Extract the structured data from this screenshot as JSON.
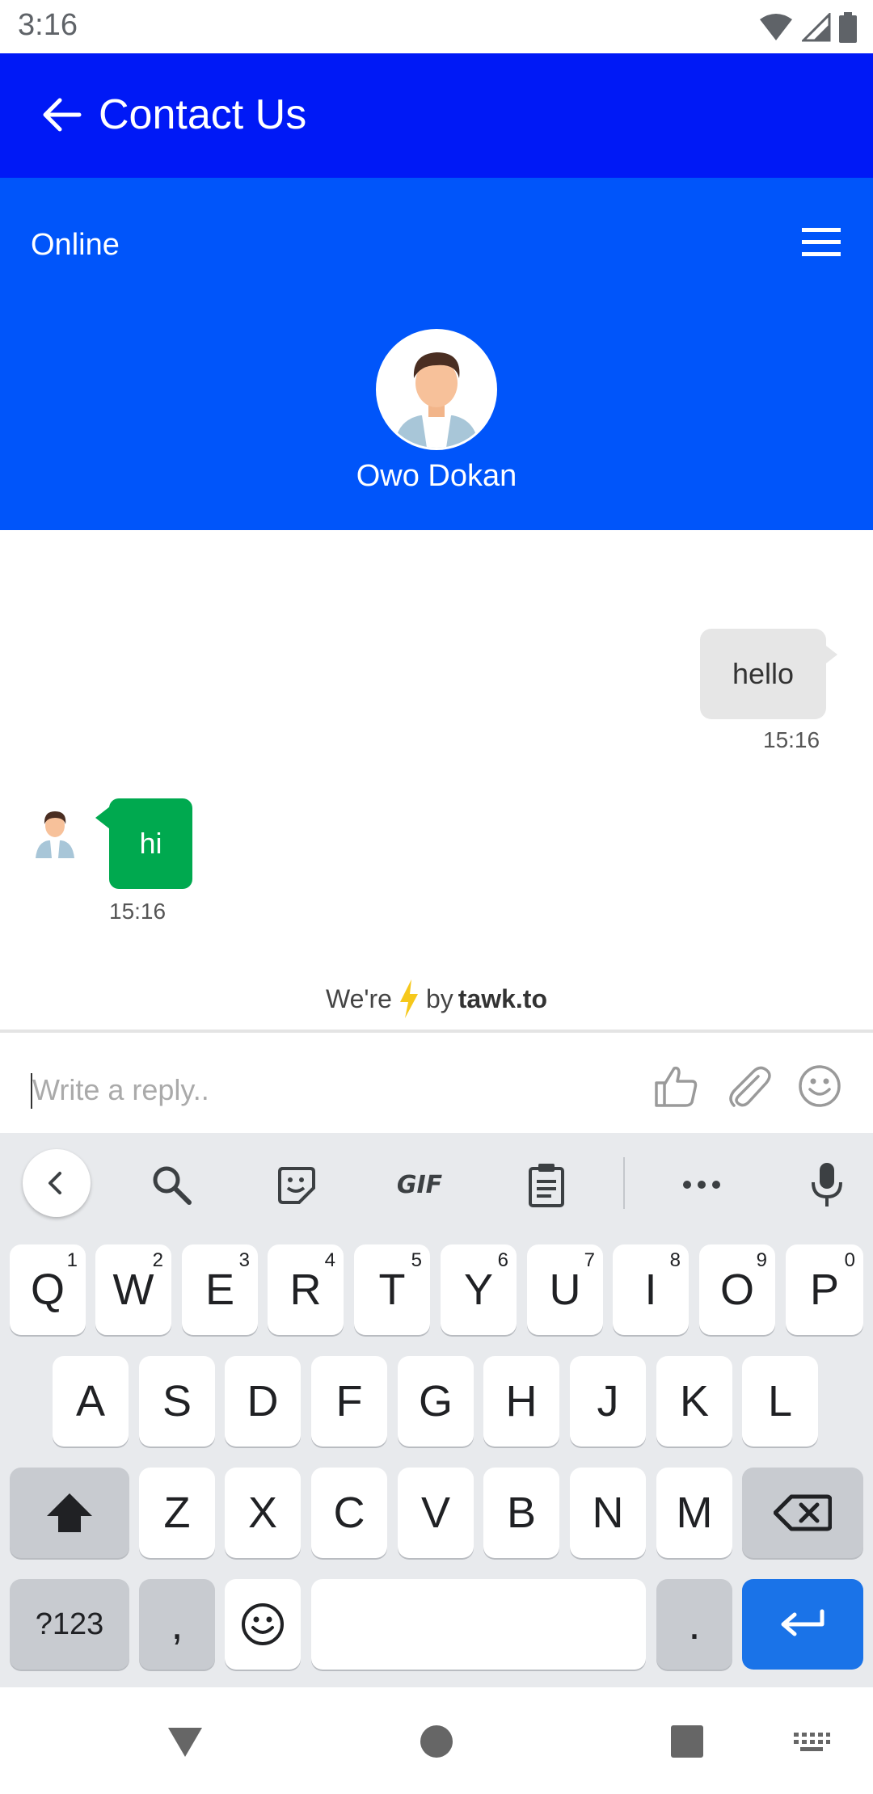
{
  "status_bar": {
    "time": "3:16",
    "icons": [
      "wifi-icon",
      "signal-icon",
      "battery-icon"
    ]
  },
  "app_bar": {
    "title": "Contact Us",
    "back_icon": "back-arrow-icon",
    "color": "#0019f6"
  },
  "chat_header": {
    "status": "Online",
    "agent_name": "Owo Dokan",
    "menu_icon": "hamburger-menu-icon",
    "color": "#0055fa"
  },
  "messages": [
    {
      "direction": "outgoing",
      "text": "hello",
      "time": "15:16",
      "bubble_color": "#e6e6e6"
    },
    {
      "direction": "incoming",
      "text": "hi",
      "time": "15:16",
      "bubble_color": "#00a94f"
    }
  ],
  "footer": {
    "prefix": "We're",
    "middle": "by",
    "brand": "tawk.to",
    "bolt_color": "#f6c81b"
  },
  "reply": {
    "placeholder": "Write a reply..",
    "value": "",
    "icons": [
      "thumbs-up-icon",
      "paperclip-icon",
      "emoji-icon"
    ]
  },
  "keyboard": {
    "toolbar": {
      "icons": [
        "collapse-chevron-icon",
        "search-icon",
        "sticker-icon",
        "gif-icon",
        "clipboard-icon",
        "more-icon",
        "microphone-icon"
      ],
      "gif_label": "GIF"
    },
    "row1": [
      {
        "label": "Q",
        "hint": "1"
      },
      {
        "label": "W",
        "hint": "2"
      },
      {
        "label": "E",
        "hint": "3"
      },
      {
        "label": "R",
        "hint": "4"
      },
      {
        "label": "T",
        "hint": "5"
      },
      {
        "label": "Y",
        "hint": "6"
      },
      {
        "label": "U",
        "hint": "7"
      },
      {
        "label": "I",
        "hint": "8"
      },
      {
        "label": "O",
        "hint": "9"
      },
      {
        "label": "P",
        "hint": "0"
      }
    ],
    "row2": [
      "A",
      "S",
      "D",
      "F",
      "G",
      "H",
      "J",
      "K",
      "L"
    ],
    "row3": [
      "Z",
      "X",
      "C",
      "V",
      "B",
      "N",
      "M"
    ],
    "symbols_label": "?123",
    "comma": ",",
    "period": ".",
    "enter_color": "#1a73e8"
  },
  "nav_bar": {
    "icons": [
      "back-triangle-icon",
      "home-circle-icon",
      "recents-square-icon",
      "keyboard-switch-icon"
    ]
  }
}
